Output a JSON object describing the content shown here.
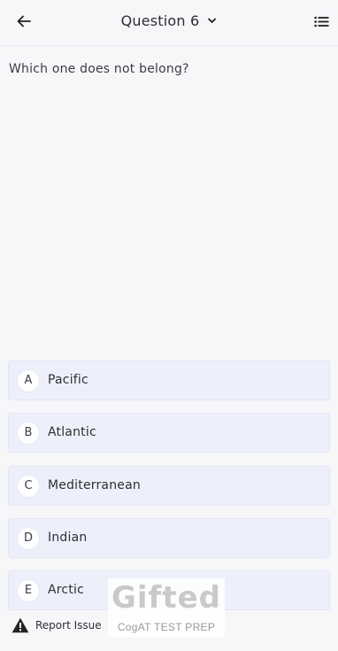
{
  "header": {
    "title": "Question 6",
    "back_icon": "arrow-left-icon",
    "dropdown_icon": "chevron-down-icon",
    "list_icon": "list-icon"
  },
  "question": {
    "text": "Which one does not belong?"
  },
  "options": [
    {
      "letter": "A",
      "label": "Pacific"
    },
    {
      "letter": "B",
      "label": "Atlantic"
    },
    {
      "letter": "C",
      "label": "Mediterranean"
    },
    {
      "letter": "D",
      "label": "Indian"
    },
    {
      "letter": "E",
      "label": "Arctic"
    }
  ],
  "footer": {
    "report_label": "Report Issue",
    "report_icon": "warning-icon"
  },
  "watermark": {
    "brand": "Gifted",
    "tagline": "CogAT TEST PREP"
  },
  "colors": {
    "background": "#f7f7fa",
    "option_background": "#edf0fb",
    "text": "#2d2f33"
  }
}
